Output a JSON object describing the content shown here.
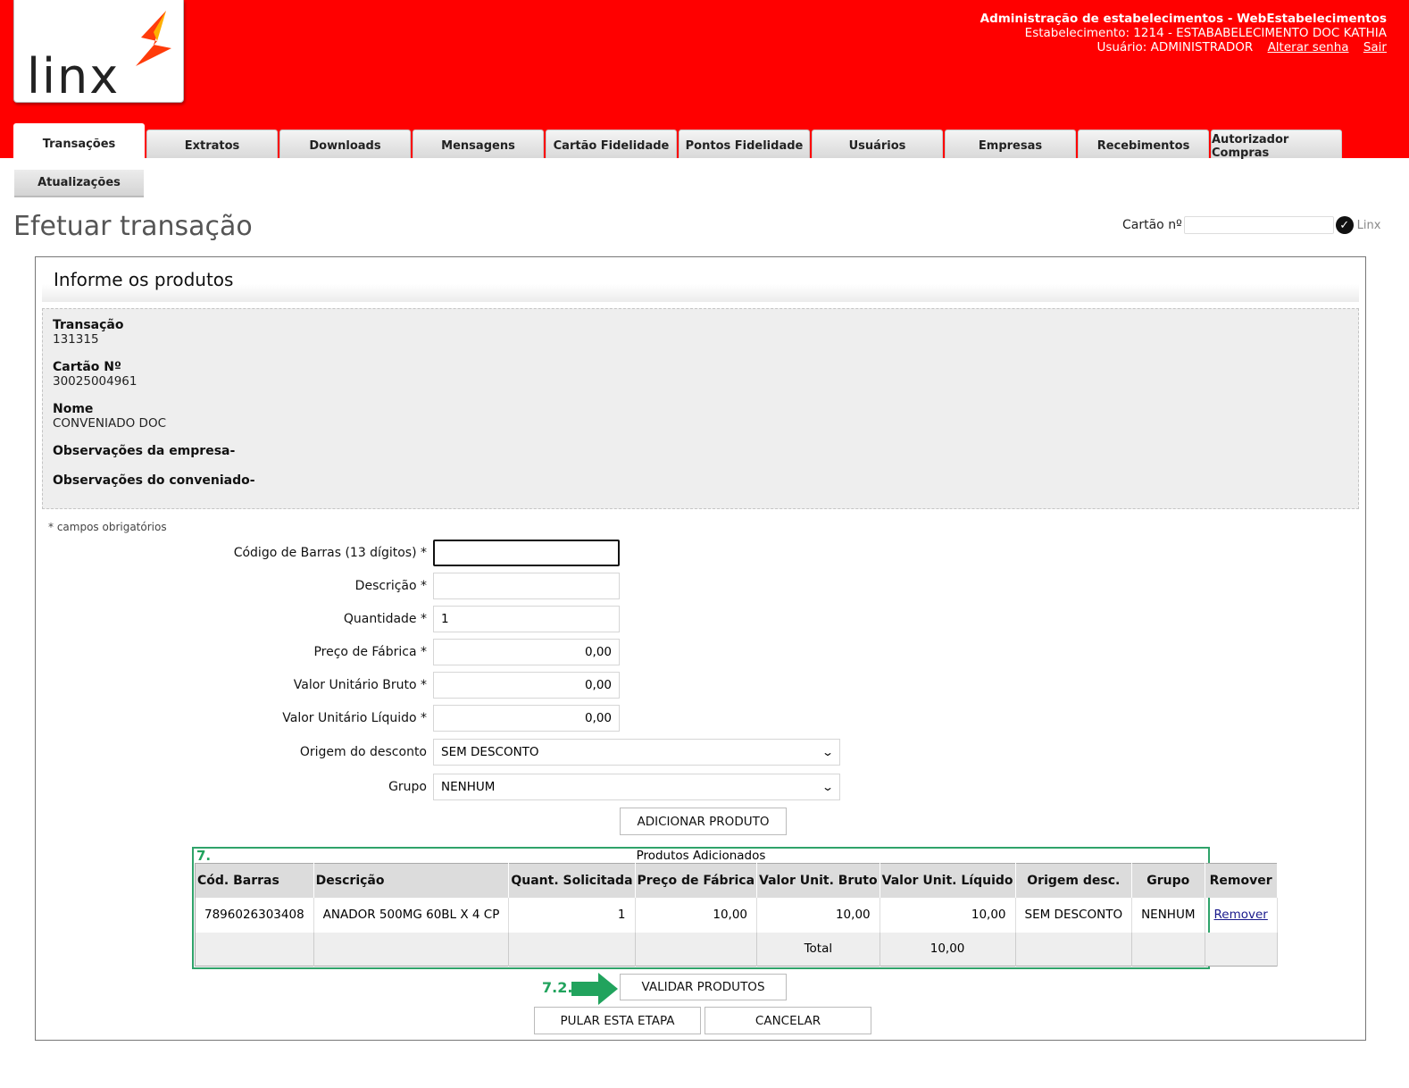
{
  "header": {
    "logo_text": "Linx",
    "title": "Administração de estabelecimentos - WebEstabelecimentos",
    "establishment": "Estabelecimento: 1214 - ESTABABELECIMENTO DOC KATHIA",
    "user": "Usuário: ADMINISTRADOR",
    "change_password": "Alterar senha",
    "logout": "Sair",
    "brand_color": "#ff0000"
  },
  "tabs": [
    {
      "label": "Transações",
      "active": true
    },
    {
      "label": "Extratos"
    },
    {
      "label": "Downloads"
    },
    {
      "label": "Mensagens"
    },
    {
      "label": "Cartão Fidelidade"
    },
    {
      "label": "Pontos Fidelidade"
    },
    {
      "label": "Usuários"
    },
    {
      "label": "Empresas"
    },
    {
      "label": "Recebimentos"
    },
    {
      "label": "Autorizador Compras"
    }
  ],
  "subtab": "Atualizações",
  "page_title": "Efetuar transação",
  "card_search": {
    "label": "Cartão nº",
    "value": "",
    "logo_text": "Linx"
  },
  "panel": {
    "title": "Informe os produtos",
    "info": {
      "transaction_label": "Transação",
      "transaction_value": "131315",
      "card_label": "Cartão Nº",
      "card_value": "30025004961",
      "name_label": "Nome",
      "name_value": "CONVENIADO DOC",
      "company_obs_label": "Observações da empresa-",
      "member_obs_label": "Observações do conveniado-"
    },
    "required_note": "* campos obrigatórios"
  },
  "form": {
    "barcode_label": "Código de Barras (13 dígitos) *",
    "barcode_value": "",
    "description_label": "Descrição *",
    "description_value": "",
    "quantity_label": "Quantidade *",
    "quantity_value": "1",
    "factory_price_label": "Preço de Fábrica *",
    "factory_price_value": "0,00",
    "gross_unit_label": "Valor Unitário Bruto *",
    "gross_unit_value": "0,00",
    "net_unit_label": "Valor Unitário Líquido *",
    "net_unit_value": "0,00",
    "discount_origin_label": "Origem do desconto",
    "discount_origin_value": "SEM DESCONTO",
    "group_label": "Grupo",
    "group_value": "NENHUM",
    "add_button": "ADICIONAR PRODUTO"
  },
  "products": {
    "step_label": "7.",
    "caption": "Produtos Adicionados",
    "columns": [
      "Cód. Barras",
      "Descrição",
      "Quant. Solicitada",
      "Preço de Fábrica",
      "Valor Unit. Bruto",
      "Valor Unit. Líquido",
      "Origem desc.",
      "Grupo",
      "Remover"
    ],
    "rows": [
      {
        "barcode": "7896026303408",
        "description": "ANADOR 500MG 60BL X 4 CP",
        "quantity": "1",
        "factory_price": "10,00",
        "gross_unit": "10,00",
        "net_unit": "10,00",
        "discount_origin": "SEM DESCONTO",
        "group": "NENHUM",
        "remove": "Remover"
      }
    ],
    "total_label": "Total",
    "total_value": "10,00"
  },
  "actions": {
    "step_label": "7.2.",
    "validate": "VALIDAR PRODUTOS",
    "skip": "PULAR ESTA ETAPA",
    "cancel": "CANCELAR",
    "highlight_color": "#21a35d"
  }
}
